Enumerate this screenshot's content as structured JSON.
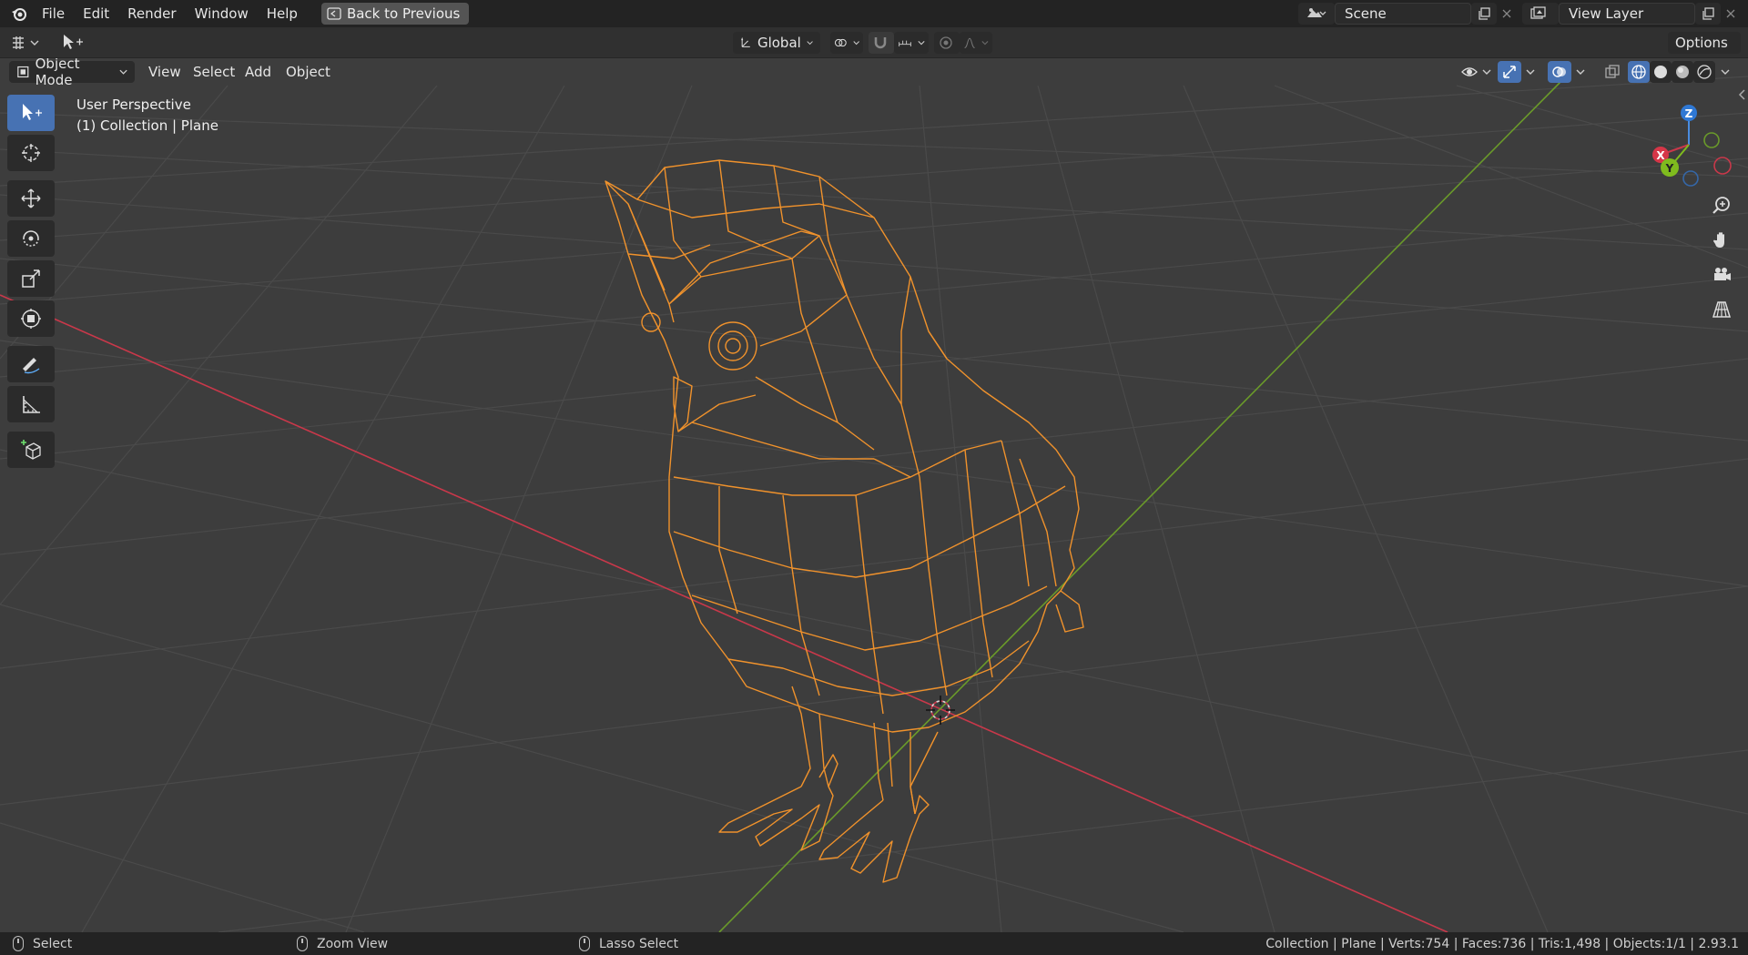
{
  "menu": {
    "items": [
      "File",
      "Edit",
      "Render",
      "Window",
      "Help"
    ],
    "back_button": "Back to Previous"
  },
  "scene": {
    "name": "Scene",
    "view_layer": "View Layer"
  },
  "toolrow": {
    "orientation": "Global",
    "options": "Options"
  },
  "viewport_header": {
    "mode": "Object Mode",
    "menus": [
      "View",
      "Select",
      "Add",
      "Object"
    ]
  },
  "overlay": {
    "perspective": "User Perspective",
    "collection": "(1) Collection | Plane"
  },
  "gizmo": {
    "x": "X",
    "y": "Y",
    "z": "Z"
  },
  "status": {
    "left": "Select",
    "middle": "Zoom View",
    "right": "Lasso Select",
    "stats": "Collection | Plane | Verts:754 | Faces:736 | Tris:1,498 | Objects:1/1 | 2.93.1"
  },
  "colors": {
    "selection": "#f0922c",
    "axis_x": "#c9384a",
    "axis_y": "#6a9a2a",
    "active_tool": "#4772b3"
  }
}
